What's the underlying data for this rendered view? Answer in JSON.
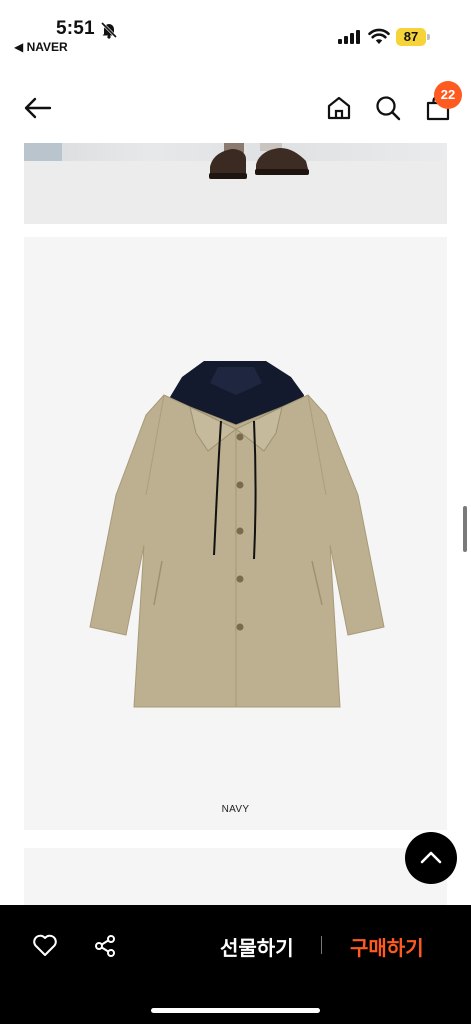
{
  "status_bar": {
    "time": "5:51",
    "back_app": "◀ NAVER",
    "battery": "87",
    "icons": [
      "bell-slash-icon",
      "signal-icon",
      "wifi-icon",
      "battery-icon"
    ]
  },
  "nav": {
    "icons": [
      "back-arrow-icon",
      "home-icon",
      "search-icon",
      "cart-icon"
    ],
    "cart_count": "22"
  },
  "product": {
    "variant_label": "NAVY"
  },
  "bottom_bar": {
    "icons": [
      "heart-icon",
      "share-icon"
    ],
    "gift_label": "선물하기",
    "buy_label": "구매하기"
  },
  "colors": {
    "accent": "#ff5a1f",
    "battery": "#f7d33a",
    "bottom_bar": "#000000"
  }
}
